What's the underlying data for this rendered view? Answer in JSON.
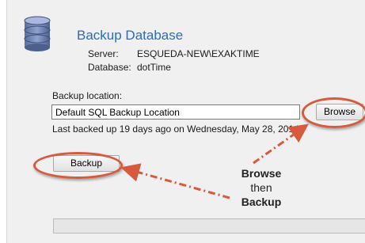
{
  "header": {
    "title": "Backup Database",
    "server_label": "Server:",
    "server_value": "ESQUEDA-NEW\\EXAKTIME",
    "database_label": "Database:",
    "database_value": "dotTime",
    "icon": "database-icon"
  },
  "backup": {
    "location_label": "Backup location:",
    "location_value": "Default SQL Backup Location",
    "browse_label": "Browse",
    "last_backup_text": "Last backed up 19 days ago on Wednesday, May 28, 2014.",
    "backup_label": "Backup"
  },
  "annotation": {
    "line1": "Browse",
    "line2": "then",
    "line3": "Backup"
  },
  "progress": {
    "value": 0
  },
  "colors": {
    "title": "#2b6cb8",
    "highlight_ring": "#d65a3c",
    "panel_background": "#f0f0f0"
  }
}
